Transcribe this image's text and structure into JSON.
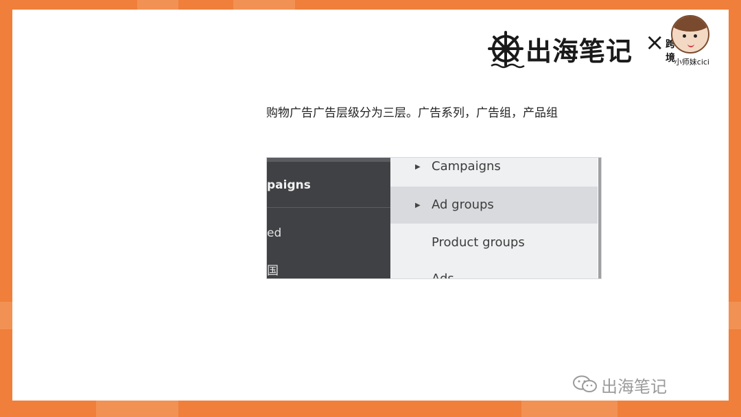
{
  "brand": {
    "title": "出海笔记",
    "cross": "×",
    "kua": "跨",
    "jing": "境",
    "handle": "小师妹cici",
    "logo_icon": "ship-wheel-anchor-icon",
    "avatar_icon": "cartoon-girl-avatar"
  },
  "caption": "购物广告广告层级分为三层。广告系列，广告组，产品组",
  "screenshot": {
    "dark_panel": {
      "items": [
        "paigns",
        "ed",
        "国"
      ]
    },
    "menu": {
      "items": [
        {
          "label": "Campaigns",
          "has_arrow": true
        },
        {
          "label": "Ad groups",
          "has_arrow": true,
          "selected": true
        },
        {
          "label": "Product groups",
          "has_arrow": false
        },
        {
          "label": "Ads",
          "has_arrow": false
        }
      ]
    }
  },
  "watermark": {
    "icon": "wechat-icon",
    "text": "出海笔记"
  },
  "colors": {
    "frame_orange": "#ef7f3a",
    "dark_panel": "#3f4144",
    "menu_bg": "#eef0f2",
    "menu_selected": "#d8dadd"
  }
}
